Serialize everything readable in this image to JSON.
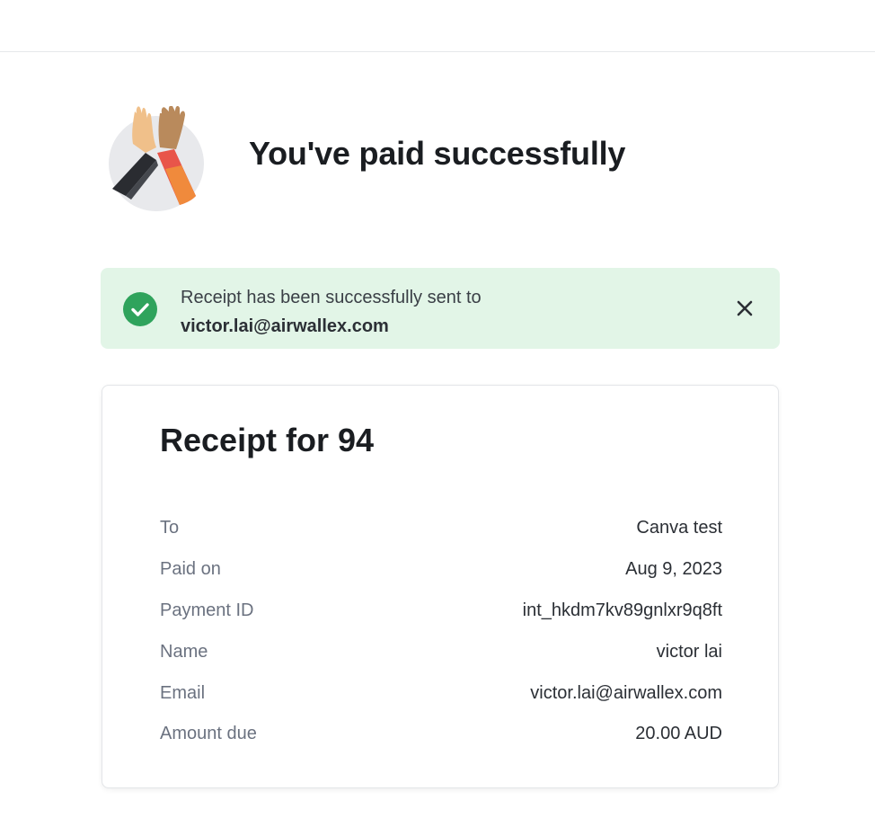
{
  "header": {
    "title": "You've paid successfully"
  },
  "banner": {
    "message": "Receipt has been successfully sent to",
    "email": "victor.lai@airwallex.com",
    "status_color": "#2fa35c",
    "background_color": "#e2f5e7",
    "icon": "check-circle-icon",
    "close_icon": "close-icon"
  },
  "receipt": {
    "title": "Receipt for 94",
    "rows": [
      {
        "label": "To",
        "value": "Canva test"
      },
      {
        "label": "Paid on",
        "value": "Aug 9, 2023"
      },
      {
        "label": "Payment ID",
        "value": "int_hkdm7kv89gnlxr9q8ft"
      },
      {
        "label": "Name",
        "value": "victor lai"
      },
      {
        "label": "Email",
        "value": "victor.lai@airwallex.com"
      },
      {
        "label": "Amount due",
        "value": "20.00 AUD"
      }
    ]
  }
}
